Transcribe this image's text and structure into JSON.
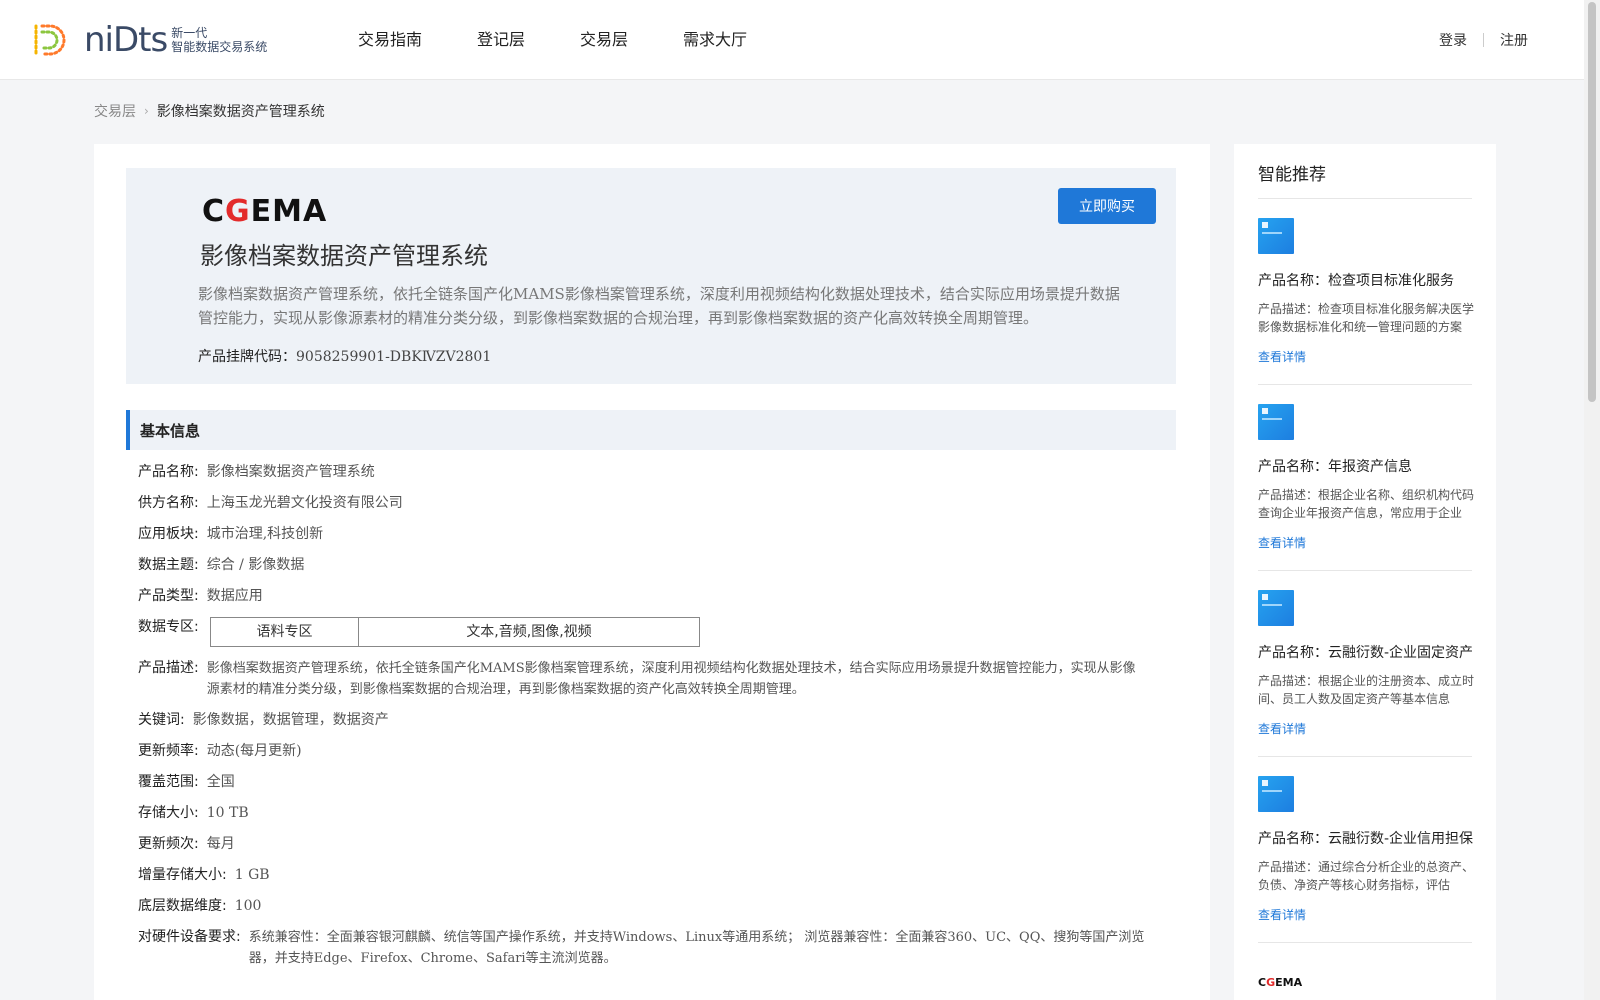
{
  "header": {
    "logo_word": "niDts",
    "logo_sub_line1": "新一代",
    "logo_sub_line2": "智能数据交易系统",
    "nav": [
      "交易指南",
      "登记层",
      "交易层",
      "需求大厅"
    ],
    "login": "登录",
    "register": "注册"
  },
  "breadcrumb": {
    "parent": "交易层",
    "current": "影像档案数据资产管理系统"
  },
  "hero": {
    "brand_c": "C",
    "brand_g": "G",
    "brand_rest": "EMA",
    "buy_label": "立即购买",
    "title": "影像档案数据资产管理系统",
    "description": "影像档案数据资产管理系统，依托全链条国产化MAMS影像档案管理系统，深度利用视频结构化数据处理技术，结合实际应用场景提升数据管控能力，实现从影像源素材的精准分类分级，到影像档案数据的合规治理，再到影像档案数据的资产化高效转换全周期管理。",
    "code_label": "产品挂牌代码：",
    "code_value": "9058259901-DBKⅣZV2801"
  },
  "section": {
    "basic_info": "基本信息"
  },
  "info": {
    "name_k": "产品名称:",
    "name_v": "影像档案数据资产管理系统",
    "supplier_k": "供方名称:",
    "supplier_v": "上海玉龙光碧文化投资有限公司",
    "block_k": "应用板块:",
    "block_v": "城市治理,科技创新",
    "theme_k": "数据主题:",
    "theme_v": "综合 / 影像数据",
    "type_k": "产品类型:",
    "type_v": "数据应用",
    "zone_k": "数据专区:",
    "zone_c1": "语料专区",
    "zone_c2": "文本,音频,图像,视频",
    "desc_k": "产品描述:",
    "desc_v": "影像档案数据资产管理系统，依托全链条国产化MAMS影像档案管理系统，深度利用视频结构化数据处理技术，结合实际应用场景提升数据管控能力，实现从影像源素材的精准分类分级，到影像档案数据的合规治理，再到影像档案数据的资产化高效转换全周期管理。",
    "keywords_k": "关键词:",
    "keywords_v": "影像数据，数据管理，数据资产",
    "freq_k": "更新频率:",
    "freq_v": "动态(每月更新)",
    "coverage_k": "覆盖范围:",
    "coverage_v": "全国",
    "storage_k": "存储大小:",
    "storage_v": "10 TB",
    "update_k": "更新频次:",
    "update_v": "每月",
    "incr_k": "增量存储大小:",
    "incr_v": "1 GB",
    "dims_k": "底层数据维度:",
    "dims_v": "100",
    "hw_k": "对硬件设备要求:",
    "hw_v": "系统兼容性：全面兼容银河麒麟、统信等国产操作系统，并支持Windows、Linux等通用系统； 浏览器兼容性：全面兼容360、UC、QQ、搜狗等国产浏览器，并支持Edge、Firefox、Chrome、Safari等主流浏览器。"
  },
  "sidebar": {
    "title": "智能推荐",
    "items": [
      {
        "name": "产品名称：检查项目标准化服务",
        "desc": "产品描述：检查项目标准化服务解决医学影像数据标准化和统一管理问题的方案",
        "link": "查看详情"
      },
      {
        "name": "产品名称：年报资产信息",
        "desc": "产品描述：根据企业名称、组织机构代码查询企业年报资产信息，常应用于企业",
        "link": "查看详情"
      },
      {
        "name": "产品名称：云融衍数-企业固定资产",
        "desc": "产品描述：根据企业的注册资本、成立时间、员工人数及固定资产等基本信息",
        "link": "查看详情"
      },
      {
        "name": "产品名称：云融衍数-企业信用担保",
        "desc": "产品描述：通过综合分析企业的总资产、负债、净资产等核心财务指标，评估",
        "link": "查看详情"
      }
    ],
    "logo_c": "C",
    "logo_g": "G",
    "logo_rest": "EMA"
  }
}
